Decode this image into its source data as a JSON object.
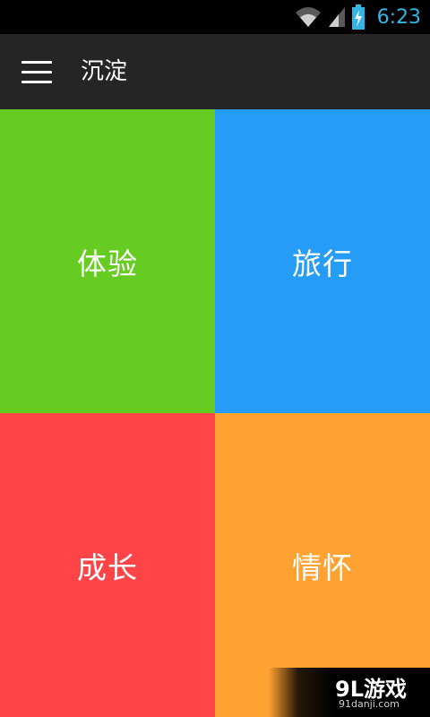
{
  "status_bar": {
    "time": "6:23",
    "icons": [
      "wifi-icon",
      "signal-icon",
      "battery-charging-icon"
    ],
    "time_color": "#33b5e5"
  },
  "action_bar": {
    "title": "沉淀",
    "menu_icon": "hamburger-menu-icon",
    "background": "#252525"
  },
  "tiles": [
    {
      "label": "体验",
      "color": "#66cc22"
    },
    {
      "label": "旅行",
      "color": "#259cf5"
    },
    {
      "label": "成长",
      "color": "#ff4447"
    },
    {
      "label": "情怀",
      "color": "#ffa232"
    }
  ],
  "watermark": {
    "brand": "9L游戏",
    "url": "91danji.com"
  }
}
